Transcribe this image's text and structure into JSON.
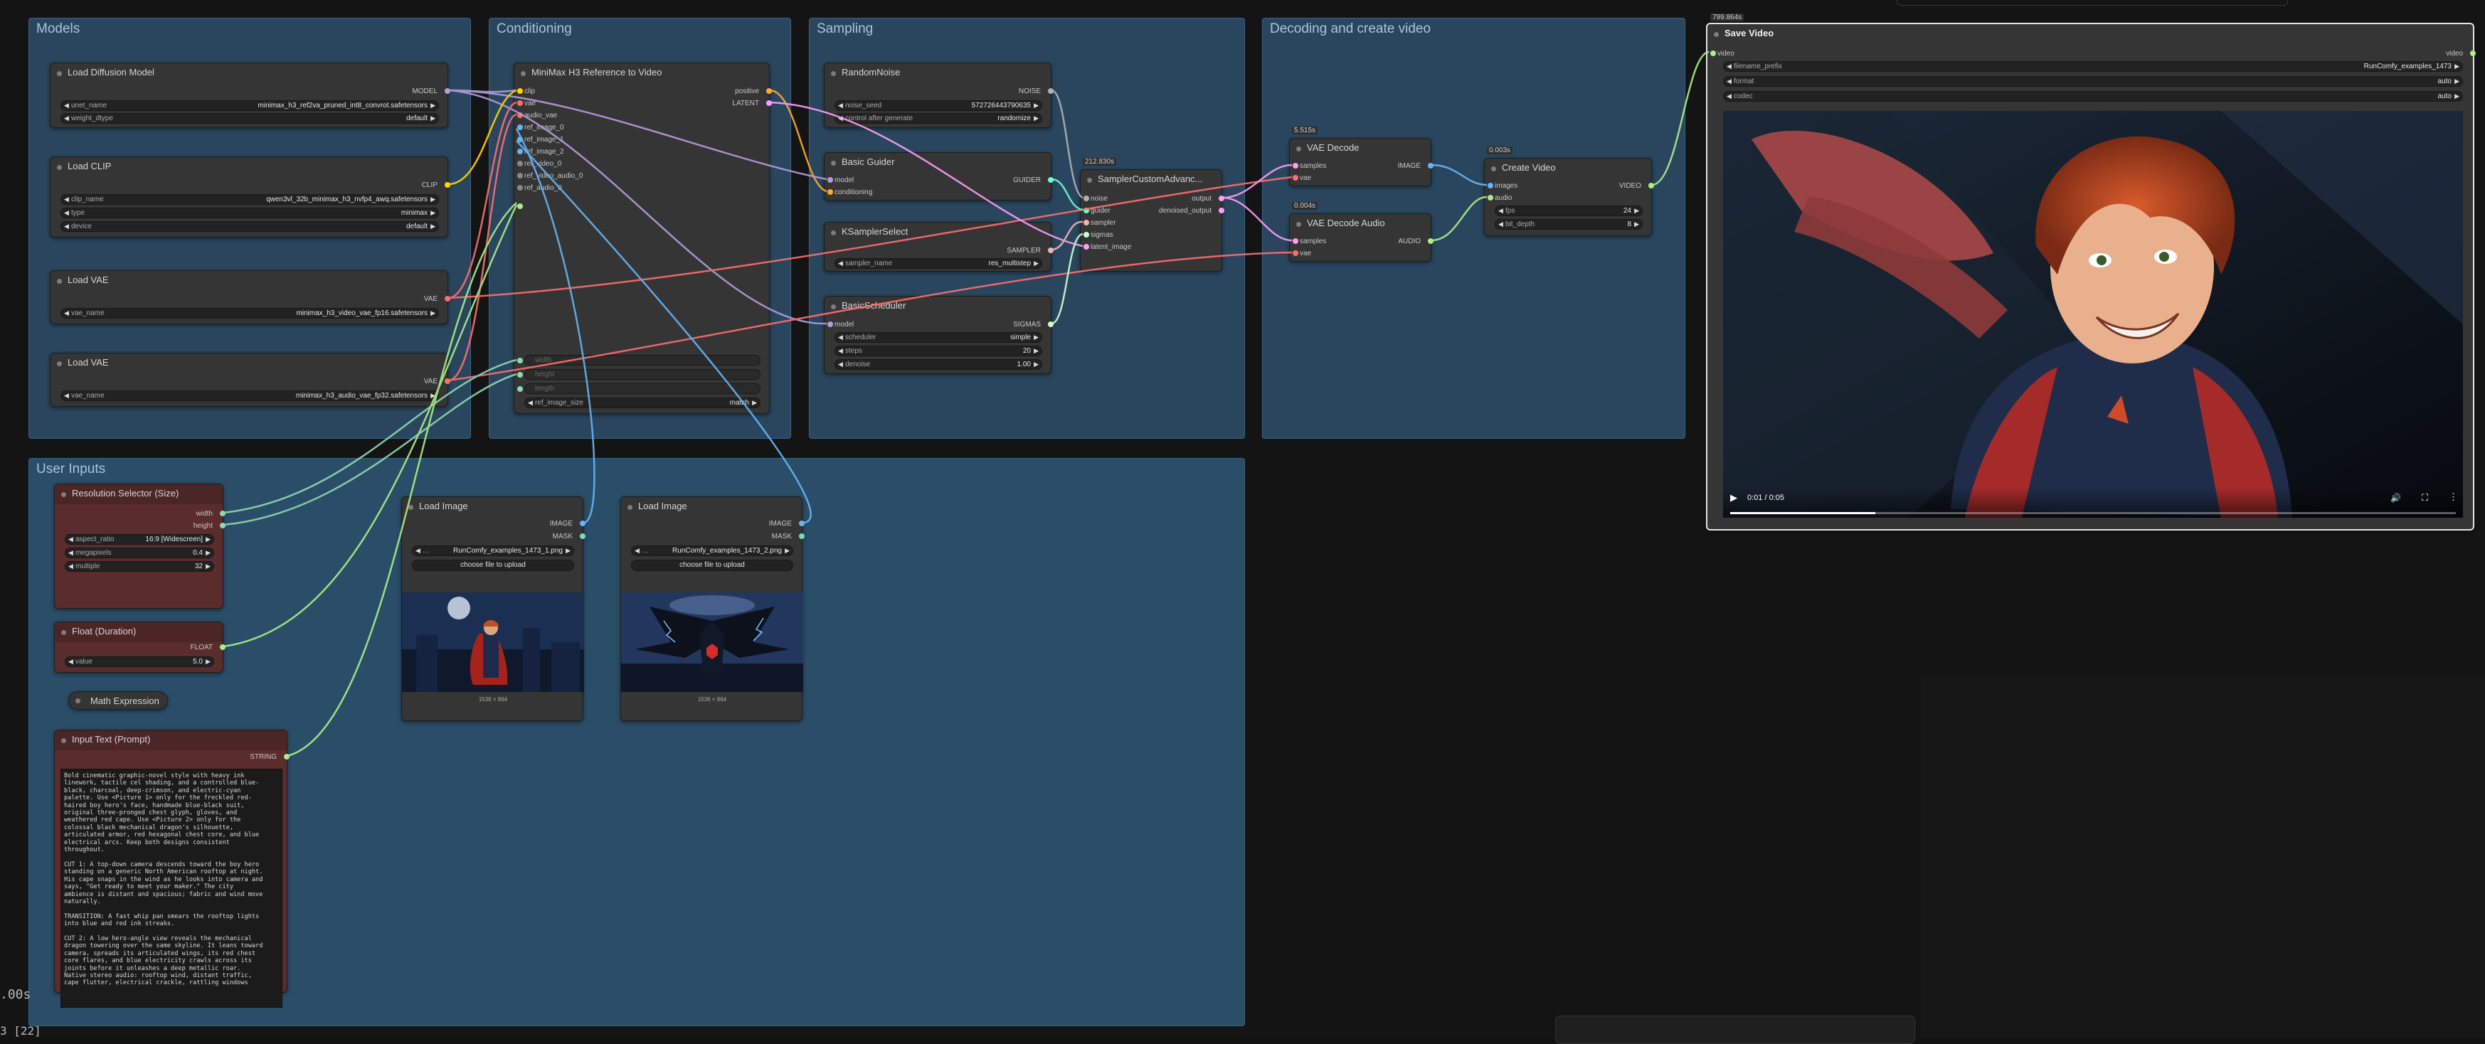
{
  "groups": {
    "models": "Models",
    "conditioning": "Conditioning",
    "sampling": "Sampling",
    "decoding": "Decoding and create video",
    "user_inputs": "User Inputs"
  },
  "colors": {
    "group_bg": "#29465e",
    "node_bg": "#353535",
    "input_node_bg": "#5a2c2c",
    "model_wire": "#b39ddb",
    "clip_wire": "#ffd500",
    "vae_wire": "#ff6e6e",
    "latent_wire": "#ff9cf9",
    "image_wire": "#64b5f6",
    "float_wire": "#aaee88",
    "int_wire": "#8fd8b0"
  },
  "nodes": {
    "load_diffusion": {
      "title": "Load Diffusion Model",
      "output": "MODEL",
      "unet_label": "unet_name",
      "unet_value": "minimax_h3_ref2va_pruned_int8_convrot.safetensors",
      "dtype_label": "weight_dtype",
      "dtype_value": "default"
    },
    "load_clip": {
      "title": "Load CLIP",
      "output": "CLIP",
      "clip_label": "clip_name",
      "clip_value": "qwen3vl_32b_minimax_h3_nvfp4_awq.safetensors",
      "type_label": "type",
      "type_value": "minimax",
      "device_label": "device",
      "device_value": "default"
    },
    "load_vae_1": {
      "title": "Load VAE",
      "output": "VAE",
      "vae_label": "vae_name",
      "vae_value": "minimax_h3_video_vae_fp16.safetensors"
    },
    "load_vae_2": {
      "title": "Load VAE",
      "output": "VAE",
      "vae_label": "vae_name",
      "vae_value": "minimax_h3_audio_vae_fp32.safetensors"
    },
    "minimax": {
      "title": "MiniMax H3 Reference to Video",
      "inputs": [
        "clip",
        "vae",
        "audio_vae",
        "ref_image_0",
        "ref_image_1",
        "ref_image_2",
        "ref_video_0",
        "ref_video_audio_0",
        "ref_audio_0"
      ],
      "outputs": [
        "positive",
        "LATENT"
      ],
      "greyed": [
        "width",
        "height",
        "length"
      ],
      "size_label": "ref_image_size",
      "size_value": "match"
    },
    "random_noise": {
      "title": "RandomNoise",
      "output": "NOISE",
      "seed_label": "noise_seed",
      "seed_value": "572726443790635",
      "control_label": "control after generate",
      "control_value": "randomize"
    },
    "basic_guider": {
      "title": "Basic Guider",
      "inputs": [
        "model",
        "conditioning"
      ],
      "output": "GUIDER"
    },
    "ksampler_select": {
      "title": "KSamplerSelect",
      "output": "SAMPLER",
      "sampler_label": "sampler_name",
      "sampler_value": "res_multistep"
    },
    "basic_scheduler": {
      "title": "BasicScheduler",
      "input": "model",
      "output": "SIGMAS",
      "scheduler_label": "scheduler",
      "scheduler_value": "simple",
      "steps_label": "steps",
      "steps_value": "20",
      "denoise_label": "denoise",
      "denoise_value": "1.00"
    },
    "sampler_custom": {
      "timing": "212.830s",
      "title": "SamplerCustomAdvanc...",
      "inputs": [
        "noise",
        "guider",
        "sampler",
        "sigmas",
        "latent_image"
      ],
      "outputs": [
        "output",
        "denoised_output"
      ]
    },
    "vae_decode": {
      "timing": "5.515s",
      "title": "VAE Decode",
      "inputs": [
        "samples",
        "vae"
      ],
      "output": "IMAGE"
    },
    "vae_decode_audio": {
      "timing": "0.004s",
      "title": "VAE Decode Audio",
      "inputs": [
        "samples",
        "vae"
      ],
      "output": "AUDIO"
    },
    "create_video": {
      "timing": "0.003s",
      "title": "Create Video",
      "inputs": [
        "images",
        "audio"
      ],
      "output": "VIDEO",
      "fps_label": "fps",
      "fps_value": "24",
      "bit_label": "bit_depth",
      "bit_value": "8"
    },
    "save_video": {
      "timing": "799.864s",
      "title": "Save Video",
      "input": "video",
      "output": "video",
      "prefix_label": "filename_prefix",
      "prefix_value": "RunComfy_examples_1473",
      "format_label": "format",
      "format_value": "auto",
      "codec_label": "codec",
      "codec_value": "auto",
      "time": "0:01 / 0:05",
      "progress": 0.2
    },
    "resolution": {
      "title": "Resolution Selector (Size)",
      "outputs": [
        "width",
        "height"
      ],
      "aspect_label": "aspect_ratio",
      "aspect_value": "16:9 [Widescreen]",
      "mp_label": "megapixels",
      "mp_value": "0.4",
      "multiple_label": "multiple",
      "multiple_value": "32"
    },
    "float_duration": {
      "title": "Float (Duration)",
      "output": "FLOAT",
      "value_label": "value",
      "value_value": "5.0"
    },
    "math_expression": {
      "title": "Math Expression"
    },
    "load_image_1": {
      "title": "Load Image",
      "outputs": [
        "IMAGE",
        "MASK"
      ],
      "file_value": "RunComfy_examples_1473_1.png",
      "upload_label": "choose file to upload",
      "dims": "1536 × 864"
    },
    "load_image_2": {
      "title": "Load Image",
      "outputs": [
        "IMAGE",
        "MASK"
      ],
      "file_value": "RunComfy_examples_1473_2.png",
      "upload_label": "choose file to upload",
      "dims": "1536 × 864"
    },
    "input_text": {
      "title": "Input Text (Prompt)",
      "output": "STRING",
      "text": "Bold cinematic graphic-novel style with heavy ink\nlinework, tactile cel shading, and a controlled blue-\nblack, charcoal, deep-crimson, and electric-cyan\npalette. Use <Picture 1> only for the freckled red-\nhaired boy hero's face, handmade blue-black suit,\noriginal three-pronged chest glyph, gloves, and\nweathered red cape. Use <Picture 2> only for the\ncolossal black mechanical dragon's silhouette,\narticulated armor, red hexagonal chest core, and blue\nelectrical arcs. Keep both designs consistent\nthroughout.\n\nCUT 1: A top-down camera descends toward the boy hero\nstanding on a generic North American rooftop at night.\nHis cape snaps in the wind as he looks into camera and\nsays, \"Get ready to meet your maker.\" The city\nambience is distant and spacious; fabric and wind move\nnaturally.\n\nTRANSITION: A fast whip pan smears the rooftop lights\ninto blue and red ink streaks.\n\nCUT 2: A low hero-angle view reveals the mechanical\ndragon towering over the same skyline. It leans toward\ncamera, spreads its articulated wings, its red chest\ncore flares, and blue electricity crawls across its\njoints before it unleashes a deep metallic roar.\nNative stereo audio: rooftop wind, distant traffic,\ncape flutter, electrical crackle, rattling windows"
    }
  },
  "status": {
    "left_text_1": ".00s",
    "left_text_2": "3 [22]"
  }
}
